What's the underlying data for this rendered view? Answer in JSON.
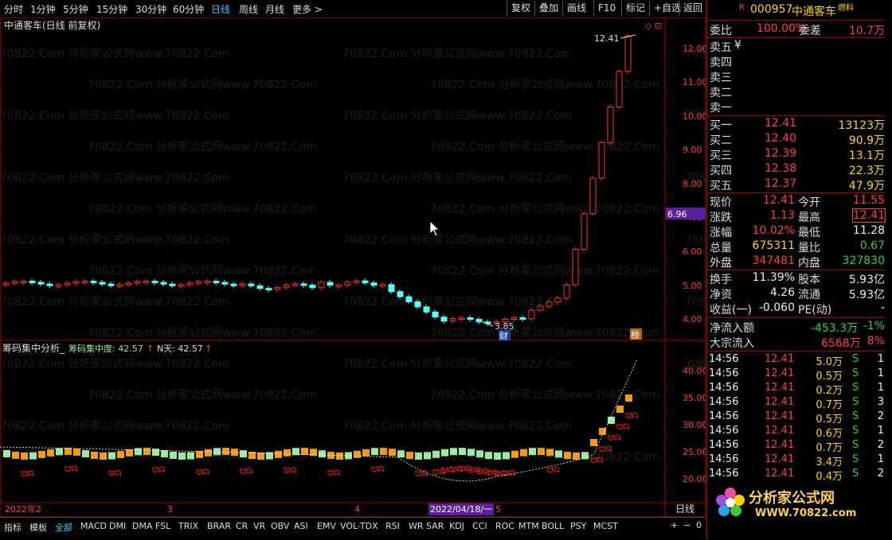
{
  "toolbar": {
    "periods": [
      "分时",
      "1分钟",
      "5分钟",
      "15分钟",
      "30分钟",
      "60分钟",
      "日线",
      "周线",
      "月线",
      "更多 >"
    ],
    "active_period": "日线",
    "buttons": [
      "复权",
      "叠加",
      "画线",
      "F10",
      "标记",
      "+自选",
      "返回"
    ]
  },
  "chart": {
    "title": "中通客车(日线 前复权)",
    "watermark": "70822.Com 分析家公式网www.70822.Com",
    "current_price_tag": "6.96",
    "high_label": "12.41",
    "low_label": "3.85",
    "badge_cai": "财",
    "badge_bang": "榜",
    "price_axis": [
      "12.00",
      "11.00",
      "10.00",
      "9.00",
      "8.00",
      "7.00",
      "6.00",
      "5.00",
      "4.00"
    ],
    "indicator_title": "筹码集中分析_",
    "indicator_line1": "筹码集中度: 42.57",
    "indicator_line2": "N天: 42.57",
    "indicator_axis": [
      "40.00",
      "35.00",
      "30.00",
      "25.00",
      "20.00"
    ],
    "date_labels": [
      "2022年2",
      "3",
      "4",
      "5"
    ],
    "cursor_date": "2022/04/18/一",
    "cycle_label": "日线",
    "zoom_controls": [
      "+",
      "−",
      "0"
    ]
  },
  "chart_data": {
    "type": "candlestick",
    "high": 12.41,
    "low": 3.85,
    "last": 12.41
  },
  "panel": {
    "flag": "R",
    "code": "000957",
    "name": "中通客车",
    "tag": "燃料",
    "weibi_label": "委比",
    "weibi": "100.00%",
    "weicha_label": "委差",
    "weicha": "10.7万",
    "sells": [
      {
        "label": "卖五",
        "price": "¥"
      },
      {
        "label": "卖四",
        "price": ""
      },
      {
        "label": "卖三",
        "price": ""
      },
      {
        "label": "卖二",
        "price": ""
      },
      {
        "label": "卖一",
        "price": ""
      }
    ],
    "buys": [
      {
        "label": "买一",
        "price": "12.41",
        "vol": "13123万"
      },
      {
        "label": "买二",
        "price": "12.40",
        "vol": "90.9万"
      },
      {
        "label": "买三",
        "price": "12.39",
        "vol": "13.1万"
      },
      {
        "label": "买四",
        "price": "12.38",
        "vol": "22.3万"
      },
      {
        "label": "买五",
        "price": "12.37",
        "vol": "47.9万"
      }
    ],
    "quote": [
      {
        "l1": "现价",
        "v1": "12.41",
        "l2": "今开",
        "v2": "11.55"
      },
      {
        "l1": "涨跌",
        "v1": "1.13",
        "l2": "最高",
        "v2": "12.41"
      },
      {
        "l1": "涨幅",
        "v1": "10.02%",
        "l2": "最低",
        "v2": "11.28"
      },
      {
        "l1": "总量",
        "v1": "675311",
        "l2": "量比",
        "v2": "0.67"
      },
      {
        "l1": "外盘",
        "v1": "347481",
        "l2": "内盘",
        "v2": "327830"
      }
    ],
    "stats": [
      {
        "l1": "换手",
        "v1": "11.39%",
        "l2": "股本",
        "v2": "5.93亿"
      },
      {
        "l1": "净资",
        "v1": "4.26",
        "l2": "流通",
        "v2": "5.93亿"
      },
      {
        "l1": "收益(一)",
        "v1": "-0.060",
        "l2": "PE(动)",
        "v2": "-"
      }
    ],
    "net_inflow_label": "净流入额",
    "net_inflow": "-453.3万",
    "net_inflow_pct": "-1%",
    "block_inflow_label": "大宗流入",
    "block_inflow": "6568万",
    "block_inflow_pct": "8%",
    "ticks": [
      {
        "t": "14:56",
        "p": "12.41",
        "v": "5.0万",
        "s": "S",
        "n": "1"
      },
      {
        "t": "14:56",
        "p": "12.41",
        "v": "0.5万",
        "s": "S",
        "n": "1"
      },
      {
        "t": "14:56",
        "p": "12.41",
        "v": "0.2万",
        "s": "S",
        "n": "1"
      },
      {
        "t": "14:56",
        "p": "12.41",
        "v": "0.7万",
        "s": "S",
        "n": "3"
      },
      {
        "t": "14:56",
        "p": "12.41",
        "v": "0.5万",
        "s": "S",
        "n": "2"
      },
      {
        "t": "14:56",
        "p": "12.41",
        "v": "0.6万",
        "s": "S",
        "n": "1"
      },
      {
        "t": "14:56",
        "p": "12.41",
        "v": "0.7万",
        "s": "S",
        "n": "2"
      },
      {
        "t": "14:56",
        "p": "12.41",
        "v": "3.4万",
        "s": "S",
        "n": "1"
      },
      {
        "t": "14:56",
        "p": "12.41",
        "v": "0.4万",
        "s": "S",
        "n": "2"
      }
    ],
    "logo_text": "分析家公式网",
    "logo_url": "WWW.70822.com"
  },
  "bottom_tabs": [
    "指标",
    "模板",
    "全部",
    "MACD",
    "DMI",
    "DMA",
    "FSL",
    "TRIX",
    "BRAR",
    "CR",
    "VR",
    "OBV",
    "ASI",
    "EMV",
    "VOL-TDX",
    "RSI",
    "WR",
    "SAR",
    "KDJ",
    "CCI",
    "ROC",
    "MTM",
    "BOLL",
    "PSY",
    "MCST"
  ],
  "active_bottom_tab": "全部",
  "colors": {
    "up": "#ff3232",
    "down": "#54ffff",
    "accent": "#46c8ff",
    "chip_orange": "#f39c12",
    "chip_green": "#9fe89f"
  }
}
